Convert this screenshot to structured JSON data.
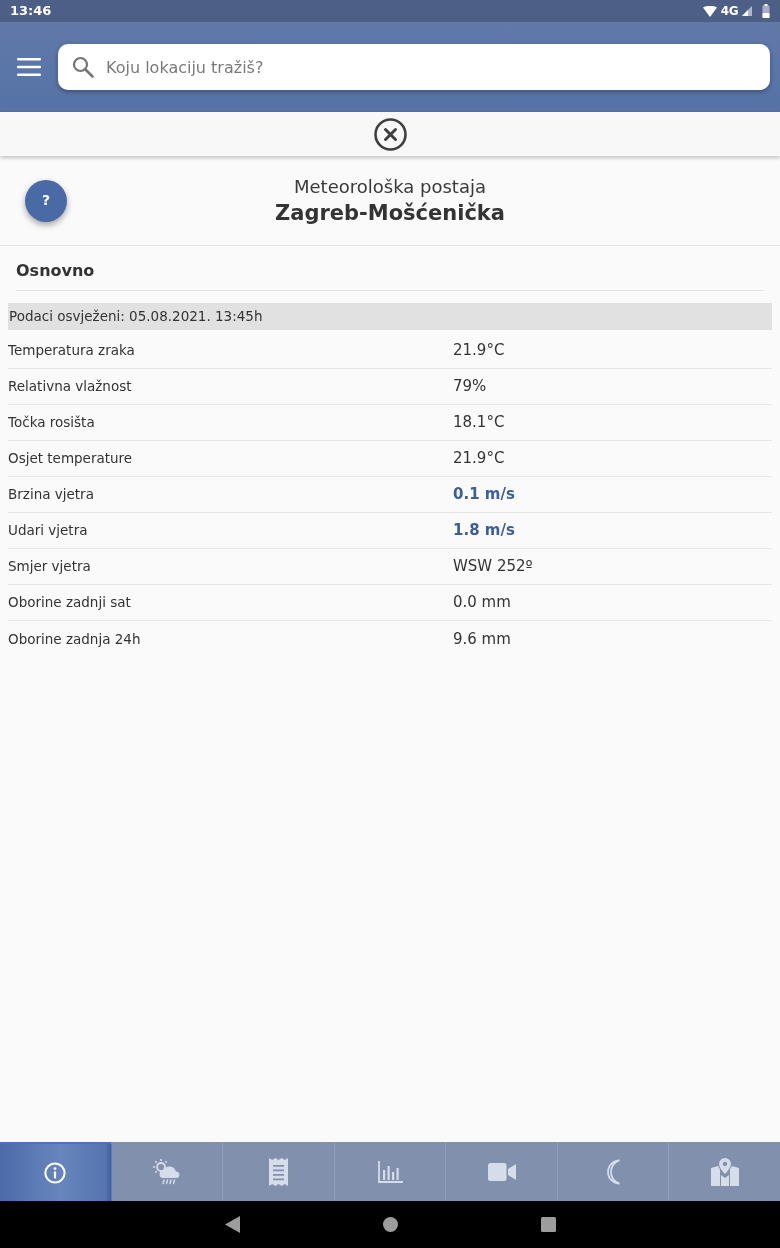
{
  "status_bar": {
    "time": "13:46",
    "network": "4G"
  },
  "search": {
    "placeholder": "Koju lokaciju tražiš?"
  },
  "station": {
    "help_label": "?",
    "subtitle": "Meteorološka postaja",
    "name": "Zagreb-Mošćenička"
  },
  "section": {
    "title": "Osnovno",
    "updated": "Podaci osvježeni: 05.08.2021. 13:45h",
    "rows": [
      {
        "label": "Temperatura zraka",
        "value": "21.9°C",
        "emphasized": false
      },
      {
        "label": "Relativna vlažnost",
        "value": "79%",
        "emphasized": false
      },
      {
        "label": "Točka rosišta",
        "value": "18.1°C",
        "emphasized": false
      },
      {
        "label": "Osjet temperature",
        "value": "21.9°C",
        "emphasized": false
      },
      {
        "label": "Brzina vjetra",
        "value": "0.1 m/s",
        "emphasized": true
      },
      {
        "label": "Udari vjetra",
        "value": "1.8 m/s",
        "emphasized": true
      },
      {
        "label": "Smjer vjetra",
        "value": "WSW 252º",
        "emphasized": false
      },
      {
        "label": "Oborine zadnji sat",
        "value": "0.0 mm",
        "emphasized": false
      },
      {
        "label": "Oborine zadnja 24h",
        "value": "9.6 mm",
        "emphasized": false
      }
    ]
  },
  "bottom_tabs": [
    {
      "kind": "info",
      "selected": true
    },
    {
      "kind": "weather",
      "selected": false
    },
    {
      "kind": "report",
      "selected": false
    },
    {
      "kind": "chart",
      "selected": false
    },
    {
      "kind": "camera",
      "selected": false
    },
    {
      "kind": "moon",
      "selected": false
    },
    {
      "kind": "map",
      "selected": false
    }
  ]
}
